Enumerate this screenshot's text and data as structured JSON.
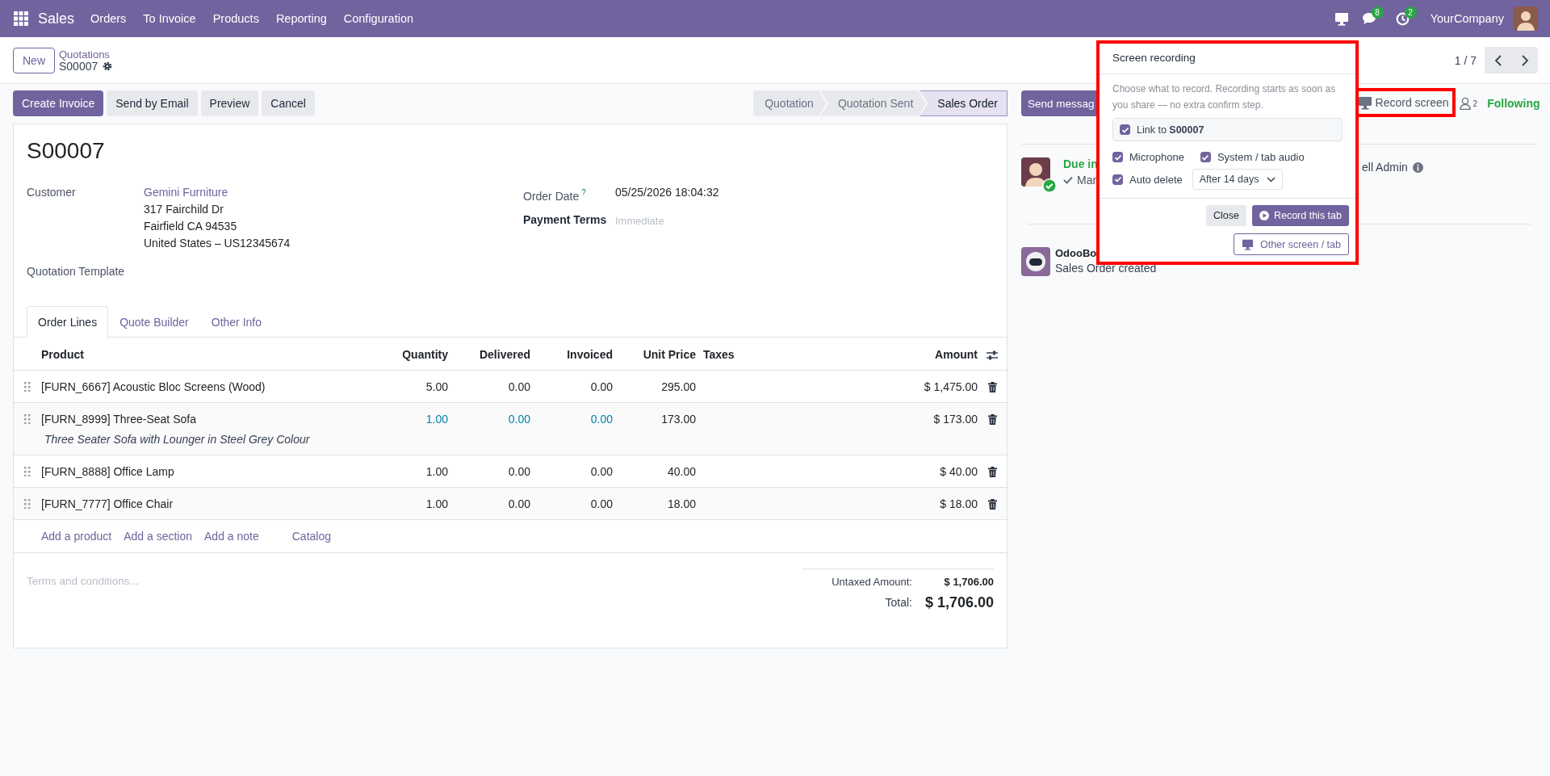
{
  "navbar": {
    "app_name": "Sales",
    "menu": [
      "Orders",
      "To Invoice",
      "Products",
      "Reporting",
      "Configuration"
    ],
    "messages_badge": "8",
    "activities_badge": "2",
    "company": "YourCompany"
  },
  "control_panel": {
    "new_button": "New",
    "breadcrumb": "Quotations",
    "record_name": "S00007",
    "pager": "1 / 7"
  },
  "action_buttons": [
    {
      "label": "Create Invoice",
      "kind": "primary"
    },
    {
      "label": "Send by Email",
      "kind": "secondary"
    },
    {
      "label": "Preview",
      "kind": "secondary"
    },
    {
      "label": "Cancel",
      "kind": "secondary"
    }
  ],
  "statusbar": [
    {
      "label": "Quotation",
      "selected": false
    },
    {
      "label": "Quotation Sent",
      "selected": false
    },
    {
      "label": "Sales Order",
      "selected": true
    }
  ],
  "form": {
    "title": "S00007",
    "customer": {
      "label": "Customer",
      "value": "Gemini Furniture",
      "address": [
        "317 Fairchild Dr",
        "Fairfield CA 94535",
        "United States – US12345674"
      ]
    },
    "quotation_template": {
      "label": "Quotation Template"
    },
    "order_date": {
      "label": "Order Date",
      "help_mark": "?",
      "value": "05/25/2026 18:04:32"
    },
    "payment_terms": {
      "label": "Payment Terms",
      "placeholder": "Immediate"
    },
    "tabs": [
      {
        "label": "Order Lines",
        "selected": true
      },
      {
        "label": "Quote Builder",
        "selected": false
      },
      {
        "label": "Other Info",
        "selected": false
      }
    ],
    "order_lines": {
      "columns": [
        "Product",
        "Quantity",
        "Delivered",
        "Invoiced",
        "Unit Price",
        "Taxes",
        "Amount"
      ],
      "rows": [
        {
          "product": "[FURN_6667] Acoustic Bloc Screens (Wood)",
          "quantity": "5.00",
          "delivered": "0.00",
          "invoiced": "0.00",
          "unit_price": "295.00",
          "amount": "$ 1,475.00",
          "highlighted": false
        },
        {
          "product": "[FURN_8999] Three-Seat Sofa",
          "description": "Three Seater Sofa with Lounger in Steel Grey Colour",
          "quantity": "1.00",
          "delivered": "0.00",
          "invoiced": "0.00",
          "unit_price": "173.00",
          "amount": "$ 173.00",
          "highlighted": true
        },
        {
          "product": "[FURN_8888] Office Lamp",
          "quantity": "1.00",
          "delivered": "0.00",
          "invoiced": "0.00",
          "unit_price": "40.00",
          "amount": "$ 40.00",
          "highlighted": false
        },
        {
          "product": "[FURN_7777] Office Chair",
          "quantity": "1.00",
          "delivered": "0.00",
          "invoiced": "0.00",
          "unit_price": "18.00",
          "amount": "$ 18.00",
          "highlighted": false
        }
      ],
      "add_links": [
        "Add a product",
        "Add a section",
        "Add a note",
        "Catalog"
      ]
    },
    "terms": {
      "placeholder": "Terms and conditions..."
    },
    "totals": [
      {
        "label": "Untaxed Amount:",
        "value": "$ 1,706.00",
        "kind": "subtotal"
      },
      {
        "label": "Total:",
        "value": "$ 1,706.00",
        "kind": "grand"
      }
    ]
  },
  "chatter": {
    "send_message": "Send messag",
    "record_screen": "Record screen",
    "followers_count": "2",
    "following": "Following",
    "activity": {
      "due": "Due in",
      "summary": "Mar",
      "assignee": "ell Admin"
    },
    "messages": [
      {
        "author": "OdooBo",
        "body": "Sales Order created"
      }
    ]
  },
  "recording_popup": {
    "title": "Screen recording",
    "description": "Choose what to record. Recording starts as soon as you share — no extra confirm step.",
    "link": {
      "label": "Link to **S00007**",
      "checked": true
    },
    "options": [
      {
        "label": "Microphone",
        "checked": true
      },
      {
        "label": "System / tab audio",
        "checked": true
      }
    ],
    "auto_delete": {
      "label": "Auto delete",
      "checked": true,
      "value": "After 14 days"
    },
    "buttons": [
      {
        "label": "Close",
        "kind": "secondary"
      },
      {
        "label": "Record this tab",
        "kind": "primary"
      }
    ],
    "other_screen": "Other screen / tab"
  }
}
